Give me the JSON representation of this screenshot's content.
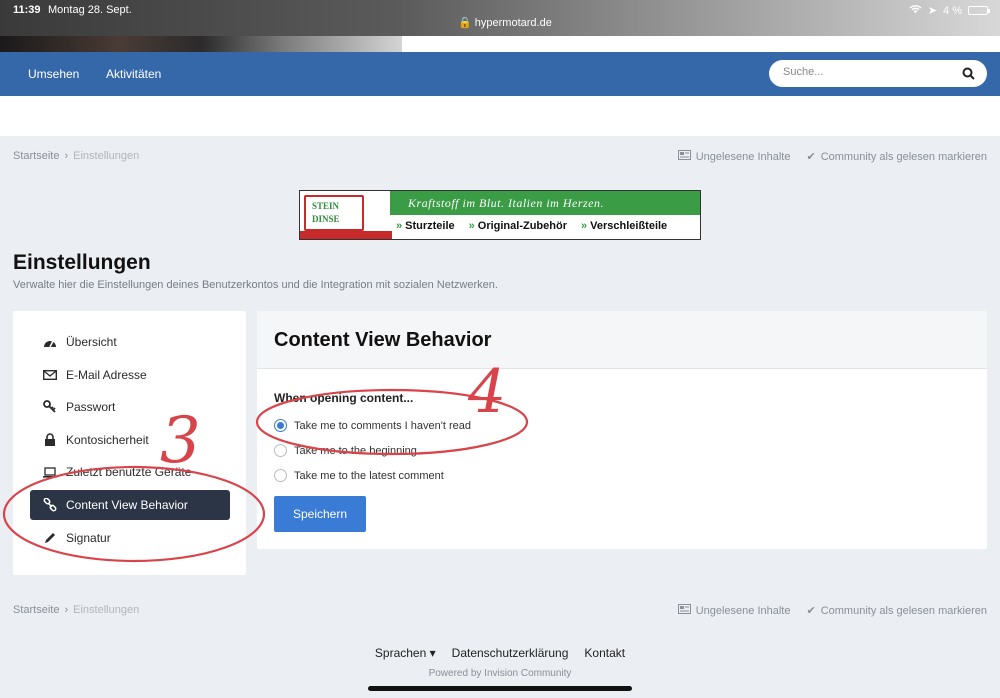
{
  "status_bar": {
    "time": "11:39",
    "date": "Montag 28. Sept.",
    "url": "hypermotard.de",
    "battery": "4 %"
  },
  "nav": {
    "items": [
      {
        "label": "Umsehen"
      },
      {
        "label": "Aktivitäten"
      }
    ],
    "search_placeholder": "Suche..."
  },
  "breadcrumb": {
    "home": "Startseite",
    "current": "Einstellungen",
    "unread": "Ungelesene Inhalte",
    "mark_read": "Community als gelesen markieren"
  },
  "ad": {
    "logo": "STEIN DINSE",
    "slogan": "Kraftstoff im Blut. Italien im Herzen.",
    "items": [
      "Sturzteile",
      "Original-Zubehör",
      "Verschleißteile"
    ]
  },
  "page": {
    "title": "Einstellungen",
    "subtitle": "Verwalte hier die Einstellungen deines Benutzerkontos und die Integration mit sozialen Netzwerken."
  },
  "sidebar": {
    "items": [
      {
        "label": "Übersicht",
        "icon": "dashboard-icon",
        "active": false
      },
      {
        "label": "E-Mail Adresse",
        "icon": "envelope-icon",
        "active": false
      },
      {
        "label": "Passwort",
        "icon": "key-icon",
        "active": false
      },
      {
        "label": "Kontosicherheit",
        "icon": "lock-icon",
        "active": false
      },
      {
        "label": "Zuletzt benutzte Geräte",
        "icon": "laptop-icon",
        "active": false
      },
      {
        "label": "Content View Behavior",
        "icon": "link-icon",
        "active": true
      },
      {
        "label": "Signatur",
        "icon": "pencil-icon",
        "active": false
      }
    ]
  },
  "panel": {
    "title": "Content View Behavior",
    "option_label": "When opening content...",
    "options": [
      {
        "label": "Take me to comments I haven't read",
        "checked": true
      },
      {
        "label": "Take me to the beginning",
        "checked": false
      },
      {
        "label": "Take me to the latest comment",
        "checked": false
      }
    ],
    "save_label": "Speichern"
  },
  "footer": {
    "languages": "Sprachen",
    "privacy": "Datenschutzerklärung",
    "contact": "Kontakt",
    "powered": "Powered by Invision Community"
  },
  "annotations": {
    "three": "3",
    "four": "4",
    "color": "#d9444a"
  },
  "colors": {
    "nav_blue": "#3468a8",
    "accent": "#3a7bd5",
    "sidebar_active": "#2c3545"
  }
}
